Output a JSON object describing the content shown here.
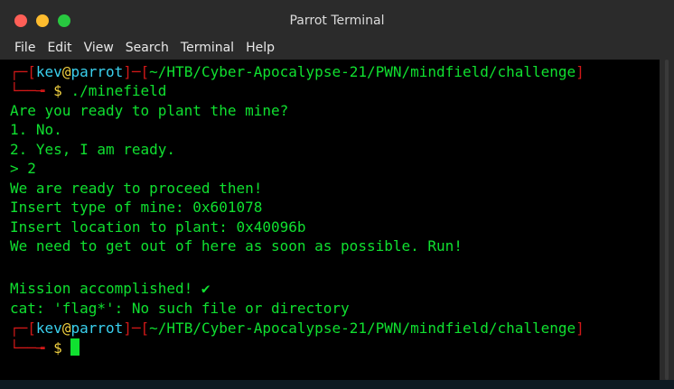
{
  "window": {
    "title": "Parrot Terminal",
    "buttons": {
      "close_color": "#ff5f57",
      "minimize_color": "#febc2e",
      "maximize_color": "#28c840"
    }
  },
  "menu": {
    "items": [
      {
        "label": "File"
      },
      {
        "label": "Edit"
      },
      {
        "label": "View"
      },
      {
        "label": "Search"
      },
      {
        "label": "Terminal"
      },
      {
        "label": "Help"
      }
    ]
  },
  "terminal": {
    "prompt": {
      "user": "kev",
      "at": "@",
      "host": "parrot",
      "path": "~/HTB/Cyber-Apocalypse-21/PWN/mindfield/challenge",
      "symbol": "$"
    },
    "command": "./minefield",
    "output": [
      "Are you ready to plant the mine?",
      "1. No.",
      "2. Yes, I am ready.",
      "> 2",
      "We are ready to proceed then!",
      "Insert type of mine: 0x601078",
      "Insert location to plant: 0x40096b",
      "We need to get out of here as soon as possible. Run!",
      "",
      "Mission accomplished! ✔",
      "cat: 'flag*': No such file or directory"
    ],
    "colors": {
      "text": "#10e030",
      "bracket": "#d01818",
      "user": "#3ad0ee",
      "at": "#f0d040",
      "background": "#000000"
    }
  }
}
